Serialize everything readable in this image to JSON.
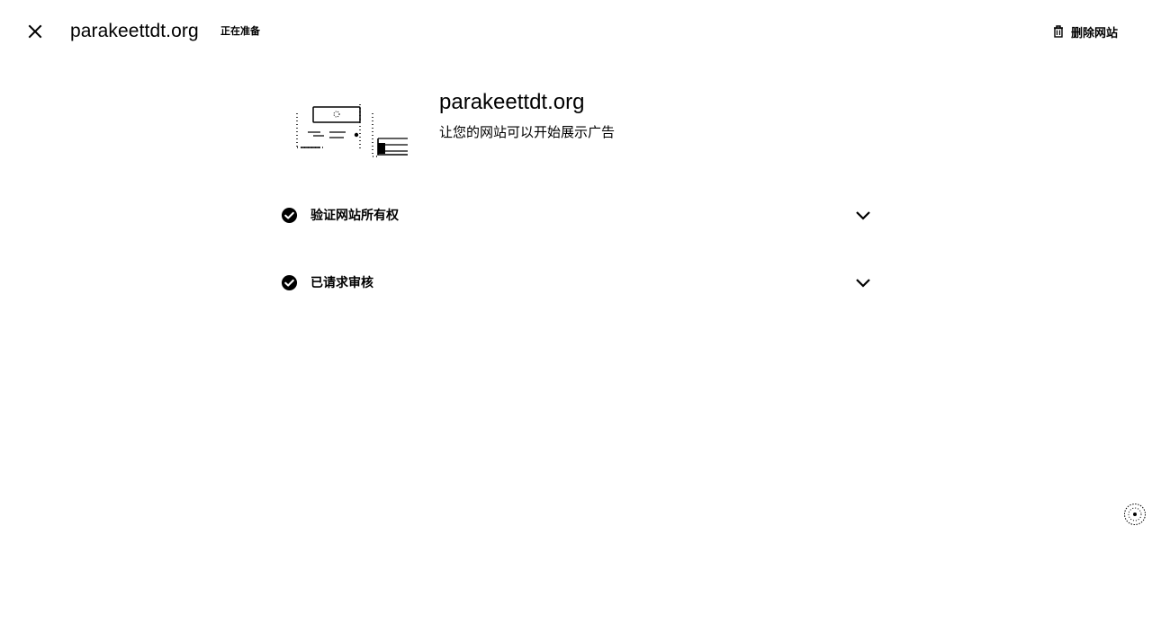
{
  "header": {
    "site_name": "parakeettdt.org",
    "status": "正在准备",
    "delete_label": "删除网站"
  },
  "hero": {
    "title": "parakeettdt.org",
    "subtitle": "让您的网站可以开始展示广告"
  },
  "steps": [
    {
      "label": "验证网站所有权",
      "completed": true
    },
    {
      "label": "已请求审核",
      "completed": true
    }
  ],
  "icons": {
    "close": "close-icon",
    "delete": "trash-icon",
    "check": "check-circle-icon",
    "chevron": "chevron-down-icon",
    "help": "help-icon"
  }
}
